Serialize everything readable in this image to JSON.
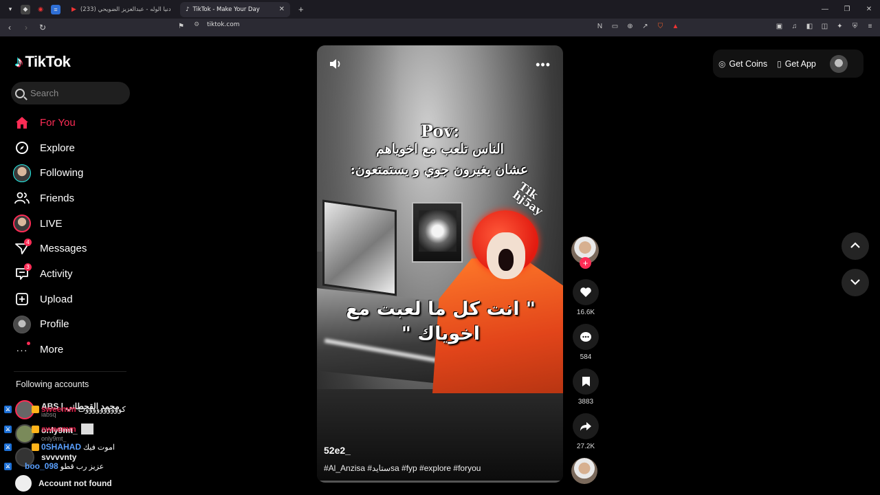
{
  "browser": {
    "tabs": [
      {
        "label": "(233) دنيا الوله - عبدالعزيز الضويحي /"
      },
      {
        "label": "TikTok - Make Your Day"
      }
    ],
    "url": "tiktok.com"
  },
  "sidebar": {
    "logo": "TikTok",
    "search_placeholder": "Search",
    "items": [
      {
        "label": "For You",
        "icon": "home-icon"
      },
      {
        "label": "Explore",
        "icon": "compass-icon"
      },
      {
        "label": "Following",
        "icon": "avatar-icon"
      },
      {
        "label": "Friends",
        "icon": "friends-icon"
      },
      {
        "label": "LIVE",
        "icon": "live-icon"
      },
      {
        "label": "Messages",
        "icon": "messages-icon",
        "badge": "4"
      },
      {
        "label": "Activity",
        "icon": "activity-icon",
        "badge": "3"
      },
      {
        "label": "Upload",
        "icon": "upload-icon"
      },
      {
        "label": "Profile",
        "icon": "avatar-icon"
      },
      {
        "label": "More",
        "icon": "more-icon"
      }
    ],
    "following_title": "Following accounts",
    "following": [
      {
        "name": "ABS | محمد القحطاني",
        "sub": "iabsq"
      },
      {
        "name": "only9mt_",
        "sub": "only9mt_"
      },
      {
        "name": "svvvvnty",
        "sub": ""
      },
      {
        "name": "Account not found",
        "sub": ""
      }
    ]
  },
  "chat": [
    {
      "user": "sweemm",
      "msg": "كووووووووووت"
    },
    {
      "user": "sweemm",
      "msg": ""
    },
    {
      "user": "0SHAHAD",
      "msg": "اموت فيك"
    },
    {
      "user": "boo_098",
      "msg": "عزيز رب قطو"
    }
  ],
  "video": {
    "caption_pov": "Pov:",
    "caption_line1": "الناس تلعب مع اخوياهم",
    "caption_line2": "عشان يغيرون جوي و يستمتعون:",
    "watermark": "Tik\nhj5ay",
    "caption_main": "\" انت كل ما لعبت مع اخوياك \"",
    "author": "52e2_",
    "description": "#Al_Anzisa #ستايدsa #fyp #explore #foryou"
  },
  "actions": {
    "likes": "16.6K",
    "comments": "584",
    "saves": "3883",
    "shares": "27.2K"
  },
  "topbar": {
    "get_coins": "Get Coins",
    "get_app": "Get App"
  },
  "colors": {
    "accent": "#fe2c55",
    "background": "#000000"
  }
}
